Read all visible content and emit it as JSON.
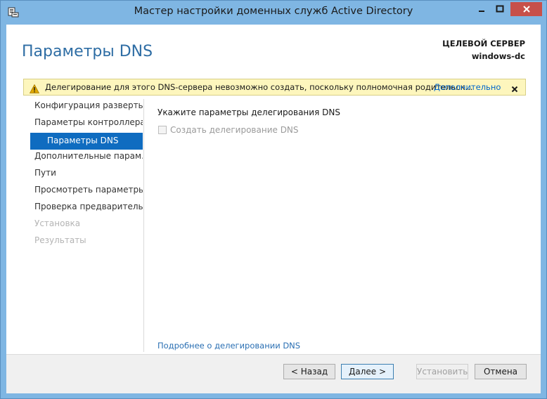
{
  "window": {
    "title": "Мастер настройки доменных служб Active Directory",
    "controls": {
      "minimize_icon": "minimize-icon",
      "maximize_icon": "maximize-icon",
      "close_icon": "close-icon"
    }
  },
  "header": {
    "page_title": "Параметры DNS",
    "target_server_label": "ЦЕЛЕВОЙ СЕРВЕР",
    "target_server_name": "windows-dc"
  },
  "warning": {
    "icon": "warning-icon",
    "text": "Делегирование для этого DNS-сервера невозможно создать, поскольку полномочная родительск...",
    "link": "Дополнительно",
    "close_icon": "close-icon"
  },
  "nav": {
    "items": [
      {
        "label": "Конфигурация разверты...",
        "state": "normal"
      },
      {
        "label": "Параметры контроллера...",
        "state": "normal"
      },
      {
        "label": "Параметры DNS",
        "state": "active"
      },
      {
        "label": "Дополнительные парам...",
        "state": "normal"
      },
      {
        "label": "Пути",
        "state": "normal"
      },
      {
        "label": "Просмотреть параметры",
        "state": "normal"
      },
      {
        "label": "Проверка предваритель...",
        "state": "normal"
      },
      {
        "label": "Установка",
        "state": "disabled"
      },
      {
        "label": "Результаты",
        "state": "disabled"
      }
    ]
  },
  "content": {
    "section_label": "Укажите параметры делегирования DNS",
    "checkbox_label": "Создать делегирование DNS",
    "checkbox_checked": false,
    "more_link": "Подробнее о делегировании DNS"
  },
  "footer": {
    "back_label": "< Назад",
    "next_label": "Далее >",
    "install_label": "Установить",
    "cancel_label": "Отмена"
  },
  "colors": {
    "window_frame": "#7fb6e3",
    "accent": "#0f6cc0",
    "title_blue": "#2e6da4",
    "link": "#0066cc",
    "warning_bg": "#fdf6bd",
    "close_button": "#c7504a"
  }
}
